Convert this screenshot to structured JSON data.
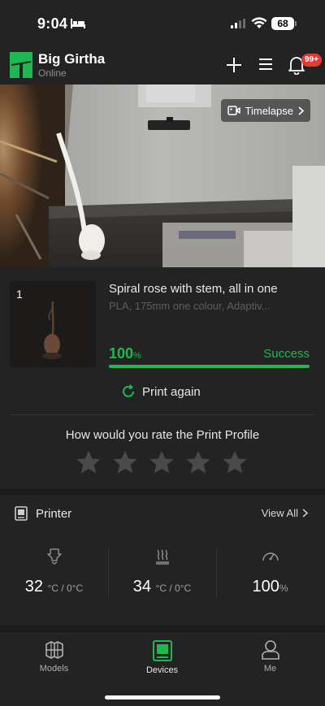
{
  "status_bar": {
    "time": "9:04",
    "battery": "68"
  },
  "header": {
    "device_name": "Big Girtha",
    "device_status": "Online",
    "notification_badge": "99+"
  },
  "camera": {
    "timelapse_label": "Timelapse"
  },
  "print_job": {
    "index": "1",
    "title": "Spiral rose with stem, all in one",
    "subtitle": "PLA, 175mm one colour, Adaptiv...",
    "progress_value": "100",
    "progress_unit": "%",
    "progress_fraction": 1.0,
    "state": "Success",
    "print_again_label": "Print again"
  },
  "rating": {
    "prompt": "How would you rate the Print Profile",
    "star_count": 5,
    "filled": 0
  },
  "printer": {
    "title": "Printer",
    "view_all_label": "View All",
    "stats": [
      {
        "icon": "nozzle-temp-icon",
        "value": "32",
        "unit": "°C / 0°C"
      },
      {
        "icon": "bed-temp-icon",
        "value": "34",
        "unit": "°C / 0°C"
      },
      {
        "icon": "speed-gauge-icon",
        "value": "100",
        "unit": "%"
      }
    ]
  },
  "tabs": [
    {
      "label": "Models",
      "icon": "models-icon",
      "active": false
    },
    {
      "label": "Devices",
      "icon": "devices-icon",
      "active": true
    },
    {
      "label": "Me",
      "icon": "profile-icon",
      "active": false
    }
  ],
  "colors": {
    "accent": "#1fb751",
    "background": "#1c1c1c",
    "card": "#232323",
    "badge": "#e53935"
  }
}
